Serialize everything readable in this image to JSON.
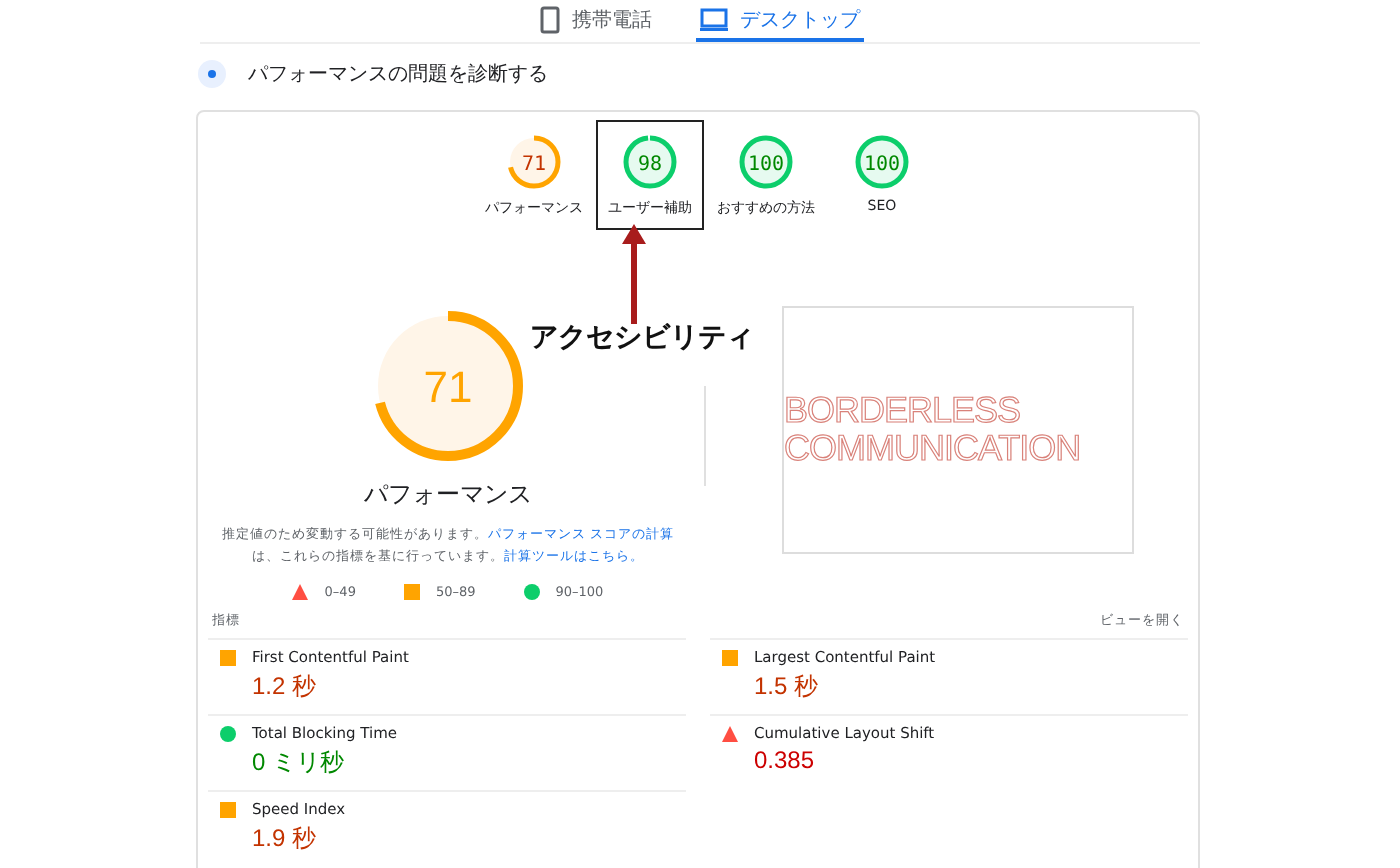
{
  "device_tabs": [
    {
      "label": "携帯電話",
      "kind": "phone",
      "selected": false
    },
    {
      "label": "デスクトップ",
      "kind": "desktop",
      "selected": true
    }
  ],
  "section": {
    "title": "パフォーマンスの問題を診断する"
  },
  "scores": [
    {
      "score": "71",
      "label": "パフォーマンス",
      "level": 0.71,
      "highlighted": false
    },
    {
      "score": "98",
      "label": "ユーザー補助",
      "level": 0.98,
      "highlighted": true
    },
    {
      "score": "100",
      "label": "おすすめの方法",
      "level": 1,
      "highlighted": false
    },
    {
      "score": "100",
      "label": "SEO",
      "level": 1,
      "highlighted": false
    }
  ],
  "annotation": {
    "label": "アクセシビリティ"
  },
  "main_score": {
    "score": "71",
    "label": "パフォーマンス",
    "level": 0.71
  },
  "description": {
    "text": "推定値のため変動する可能性があります。",
    "link_1": "パフォーマンス スコアの計算",
    "text_2": "は、これらの指標を基に行っています。",
    "link_2": "計算ツールはこちら。"
  },
  "legend": [
    {
      "kind": "poor",
      "label": "0–49"
    },
    {
      "kind": "average",
      "label": "50–89"
    },
    {
      "kind": "good",
      "label": "90–100"
    }
  ],
  "screenshot": {
    "line_1": "BORDERLESS",
    "line_2": "COMMUNICATION"
  },
  "metrics_header": {
    "title": "指標",
    "toggle": "ビューを開く"
  },
  "metrics": [
    {
      "name": "First Contentful Paint",
      "value": "1.2 秒",
      "kind": "average"
    },
    {
      "name": "Largest Contentful Paint",
      "value": "1.5 秒",
      "kind": "average"
    },
    {
      "name": "Total Blocking Time",
      "value": "0 ミリ秒",
      "kind": "good"
    },
    {
      "name": "Cumulative Layout Shift",
      "value": "0.385",
      "kind": "poor"
    },
    {
      "name": "Speed Index",
      "value": "1.9 秒",
      "kind": "average"
    }
  ]
}
